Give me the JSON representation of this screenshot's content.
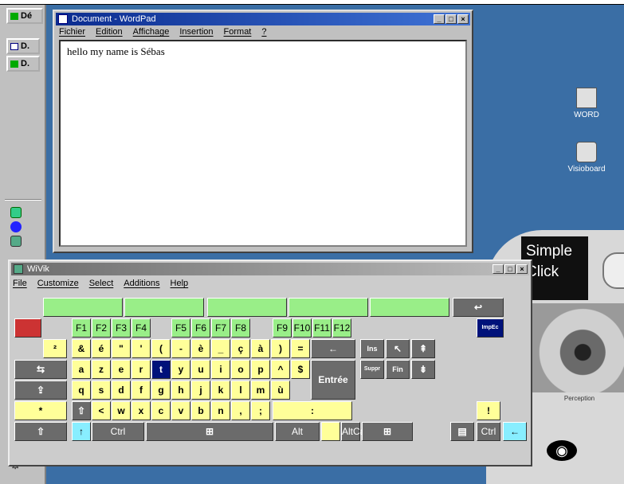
{
  "taskbar": {
    "buttons": [
      "Dé",
      "D.",
      "D."
    ]
  },
  "wordpad": {
    "title": "Document - WordPad",
    "menu": [
      "Fichier",
      "Edition",
      "Affichage",
      "Insertion",
      "Format",
      "?"
    ],
    "content": "hello my name is Sébas",
    "btns": [
      "_",
      "□",
      "×"
    ]
  },
  "desktop_icons": [
    {
      "label": "WORD",
      "icon": "word-doc-icon"
    },
    {
      "label": "Visioboard",
      "icon": "visioboard-icon"
    }
  ],
  "simple_click": {
    "line1": "Simple",
    "line2": "Click",
    "perception": "Perception",
    "eye_glyph": "◉"
  },
  "wivik": {
    "title": "WiVik",
    "menu": [
      "File",
      "Customize",
      "Select",
      "Additions",
      "Help"
    ],
    "btns": [
      "_",
      "□",
      "×"
    ],
    "colors": {
      "yellow": "#ffff99",
      "green": "#99ee88",
      "gray": "#6b6b6b",
      "cyan": "#88eeff",
      "red": "#cc3333",
      "navy": "#00127a"
    },
    "keys": [
      {
        "l": "",
        "c": "k-g"
      },
      {
        "l": "",
        "c": "k-g"
      },
      {
        "l": "",
        "c": "k-g"
      },
      {
        "l": "",
        "c": "k-g"
      },
      {
        "l": "",
        "c": "k-g"
      },
      {
        "l": "↩",
        "c": "k-gray"
      },
      {
        "l": "",
        "c": "k-r"
      },
      {
        "l": "F1",
        "c": "k-g k-o"
      },
      {
        "l": "F2",
        "c": "k-g k-o"
      },
      {
        "l": "F3",
        "c": "k-g k-o"
      },
      {
        "l": "F4",
        "c": "k-g k-o"
      },
      {
        "l": "F5",
        "c": "k-g k-o"
      },
      {
        "l": "F6",
        "c": "k-g k-o"
      },
      {
        "l": "F7",
        "c": "k-g k-o"
      },
      {
        "l": "F8",
        "c": "k-g k-o"
      },
      {
        "l": "F9",
        "c": "k-g k-o"
      },
      {
        "l": "F10",
        "c": "k-g k-o"
      },
      {
        "l": "F11",
        "c": "k-g k-o"
      },
      {
        "l": "F12",
        "c": "k-g k-o"
      },
      {
        "l": "ImpEc",
        "c": "k-n k-s"
      },
      {
        "l": "²",
        "c": "k-y"
      },
      {
        "l": "&",
        "c": "k-y"
      },
      {
        "l": "é",
        "c": "k-y"
      },
      {
        "l": "\"",
        "c": "k-y"
      },
      {
        "l": "'",
        "c": "k-y"
      },
      {
        "l": "(",
        "c": "k-y"
      },
      {
        "l": "-",
        "c": "k-y"
      },
      {
        "l": "è",
        "c": "k-y"
      },
      {
        "l": "_",
        "c": "k-y"
      },
      {
        "l": "ç",
        "c": "k-y"
      },
      {
        "l": "à",
        "c": "k-y"
      },
      {
        "l": ")",
        "c": "k-y"
      },
      {
        "l": "=",
        "c": "k-y"
      },
      {
        "l": "←",
        "c": "k-gray"
      },
      {
        "l": "Ins",
        "c": "k-gray k-sm"
      },
      {
        "l": "↖",
        "c": "k-gray"
      },
      {
        "l": "⇞",
        "c": "k-gray"
      },
      {
        "l": "⇆",
        "c": "k-gray"
      },
      {
        "l": "a",
        "c": "k-y"
      },
      {
        "l": "z",
        "c": "k-y"
      },
      {
        "l": "e",
        "c": "k-y"
      },
      {
        "l": "r",
        "c": "k-y"
      },
      {
        "l": "t",
        "c": "k-n"
      },
      {
        "l": "y",
        "c": "k-y"
      },
      {
        "l": "u",
        "c": "k-y"
      },
      {
        "l": "i",
        "c": "k-y"
      },
      {
        "l": "o",
        "c": "k-y"
      },
      {
        "l": "p",
        "c": "k-y"
      },
      {
        "l": "^",
        "c": "k-y"
      },
      {
        "l": "$",
        "c": "k-y"
      },
      {
        "l": "Entrée",
        "c": "k-gray"
      },
      {
        "l": "Suppr",
        "c": "k-gray k-s"
      },
      {
        "l": "Fin",
        "c": "k-gray k-sm"
      },
      {
        "l": "⇟",
        "c": "k-gray"
      },
      {
        "l": "⇪",
        "c": "k-gray"
      },
      {
        "l": "q",
        "c": "k-y"
      },
      {
        "l": "s",
        "c": "k-y"
      },
      {
        "l": "d",
        "c": "k-y"
      },
      {
        "l": "f",
        "c": "k-y"
      },
      {
        "l": "g",
        "c": "k-y"
      },
      {
        "l": "h",
        "c": "k-y"
      },
      {
        "l": "j",
        "c": "k-y"
      },
      {
        "l": "k",
        "c": "k-y"
      },
      {
        "l": "l",
        "c": "k-y"
      },
      {
        "l": "m",
        "c": "k-y"
      },
      {
        "l": "ù",
        "c": "k-y"
      },
      {
        "l": "*",
        "c": "k-y"
      },
      {
        "l": "⇧",
        "c": "k-gray"
      },
      {
        "l": "<",
        "c": "k-y"
      },
      {
        "l": "w",
        "c": "k-y"
      },
      {
        "l": "x",
        "c": "k-y"
      },
      {
        "l": "c",
        "c": "k-y"
      },
      {
        "l": "v",
        "c": "k-y"
      },
      {
        "l": "b",
        "c": "k-y"
      },
      {
        "l": "n",
        "c": "k-y"
      },
      {
        "l": ",",
        "c": "k-y"
      },
      {
        "l": ";",
        "c": "k-y"
      },
      {
        "l": ":",
        "c": "k-y"
      },
      {
        "l": "!",
        "c": "k-y"
      },
      {
        "l": "⇧",
        "c": "k-gray"
      },
      {
        "l": "↑",
        "c": "k-c"
      },
      {
        "l": "Ctrl",
        "c": "k-gray k-o"
      },
      {
        "l": "⊞",
        "c": "k-gray"
      },
      {
        "l": "Alt",
        "c": "k-gray k-o"
      },
      {
        "l": "",
        "c": "k-y"
      },
      {
        "l": "AltCar",
        "c": "k-gray k-o"
      },
      {
        "l": "⊞",
        "c": "k-gray"
      },
      {
        "l": "▤",
        "c": "k-gray"
      },
      {
        "l": "Ctrl",
        "c": "k-gray k-o"
      },
      {
        "l": "←",
        "c": "k-c"
      },
      {
        "l": "↓",
        "c": "k-c"
      },
      {
        "l": "→",
        "c": "k-c"
      }
    ]
  }
}
